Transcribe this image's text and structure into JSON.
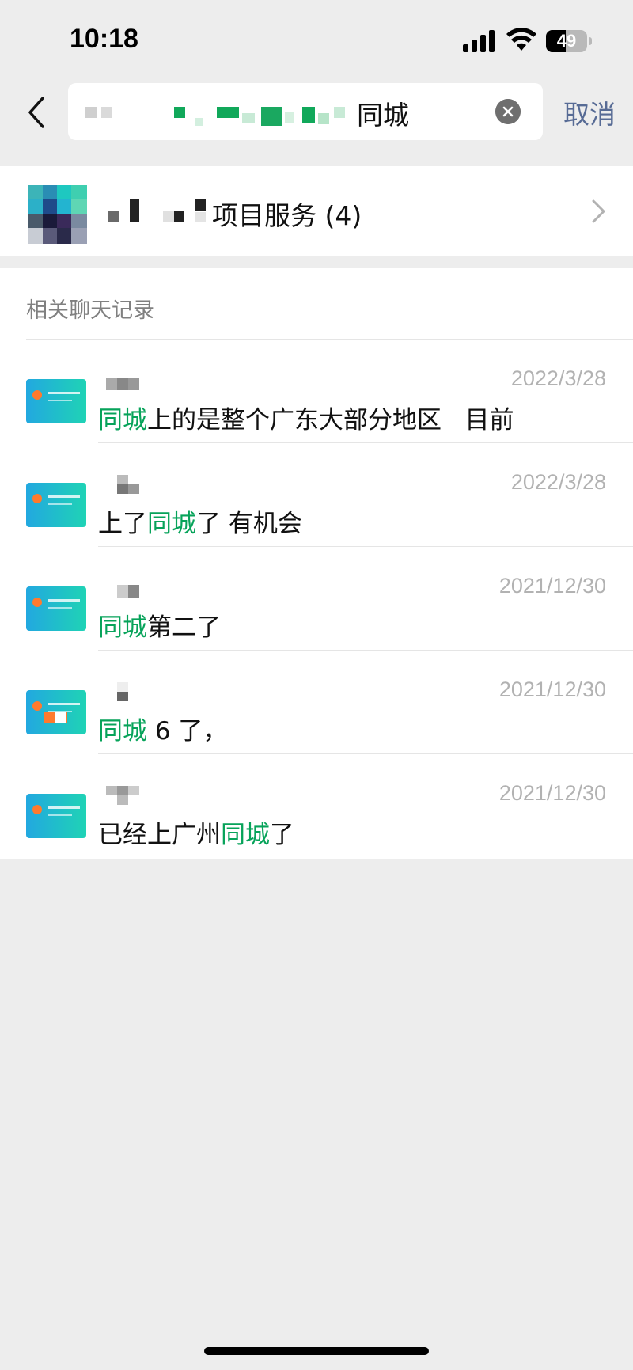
{
  "status_bar": {
    "time": "10:18",
    "battery_level": "49",
    "battery_fraction": 0.49
  },
  "header": {
    "search_keyword": "同城",
    "cancel_label": "取消"
  },
  "group": {
    "name": "项目服务 (4)"
  },
  "records_section": {
    "title": "相关聊天记录",
    "items": [
      {
        "date": "2022/3/28",
        "pre": "",
        "keyword": "同城",
        "post": "上的是整个广东大部分地区   目前"
      },
      {
        "date": "2022/3/28",
        "pre": "上了",
        "keyword": "同城",
        "post": "了 有机会"
      },
      {
        "date": "2021/12/30",
        "pre": "",
        "keyword": "同城",
        "post": "第二了"
      },
      {
        "date": "2021/12/30",
        "pre": "",
        "keyword": "同城",
        "post": " 6 了，"
      },
      {
        "date": "2021/12/30",
        "pre": "已经上广州",
        "keyword": "同城",
        "post": "了"
      }
    ]
  },
  "colors": {
    "highlight": "#07a35a",
    "link": "#576b95",
    "background": "#ededed"
  }
}
